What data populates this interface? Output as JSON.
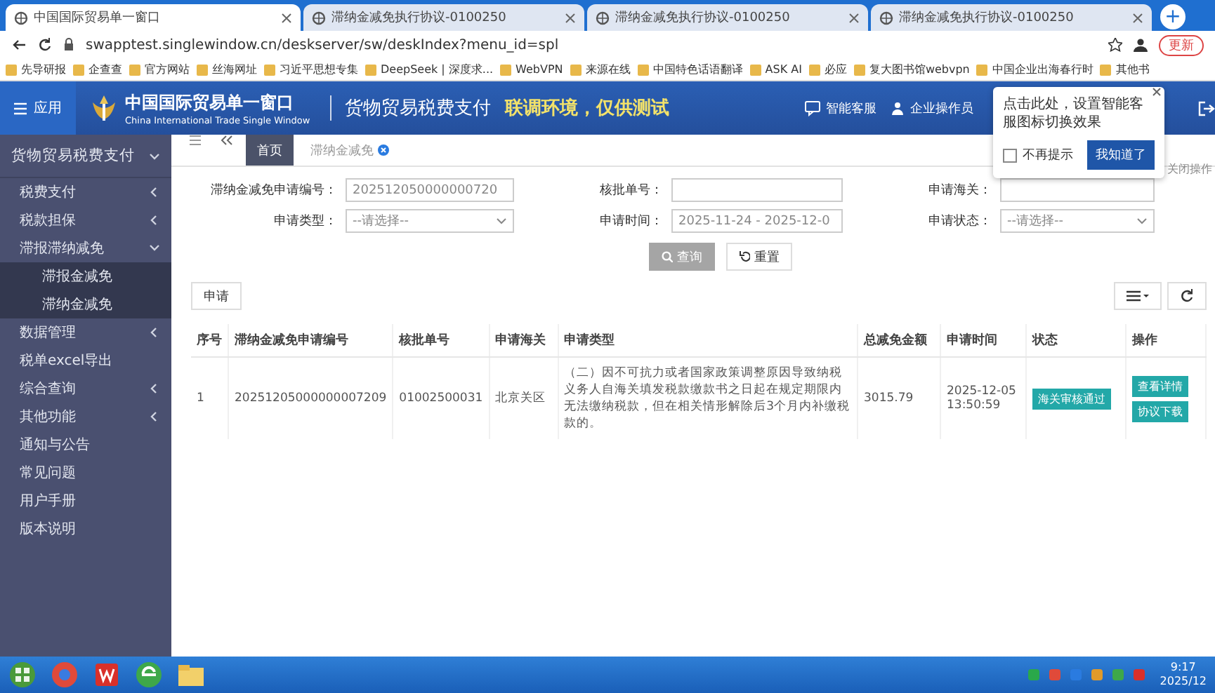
{
  "browser": {
    "tabs": [
      {
        "title": "中国国际贸易单一窗口",
        "selected": true
      },
      {
        "title": "滞纳金减免执行协议-0100250",
        "selected": false
      },
      {
        "title": "滞纳金减免执行协议-0100250",
        "selected": false
      },
      {
        "title": "滞纳金减免执行协议-0100250",
        "selected": false
      }
    ],
    "new_tab": "+",
    "url": "swapptest.singlewindow.cn/deskserver/sw/deskIndex?menu_id=spl",
    "update_button": "更新",
    "bookmarks": [
      "先导研报",
      "企查查",
      "官方网站",
      "丝海网址",
      "习近平思想专集",
      "DeepSeek | 深度求...",
      "WebVPN",
      "来源在线",
      "中国特色话语翻译",
      "ASK AI",
      "必应",
      "复大图书馆webvpn",
      "中国企业出海春行时",
      "其他书"
    ]
  },
  "header": {
    "menu_label": "应用",
    "logo_title": "中国国际贸易单一窗口",
    "logo_subtitle": "China International Trade Single Window",
    "system": "货物贸易税费支付",
    "env_notice": "联调环境，仅供测试",
    "links": [
      "智能客服",
      "企业操作员"
    ]
  },
  "popup": {
    "message": "点击此处，设置智能客服图标切换效果",
    "checkbox": {
      "label": "不再提示",
      "checked": false
    },
    "button": "我知道了",
    "behind_text": "关闭操作"
  },
  "sidebar": {
    "title": "货物贸易税费支付",
    "items": [
      {
        "label": "税费支付",
        "kind": "group",
        "expanded": false
      },
      {
        "label": "税款担保",
        "kind": "group",
        "expanded": false
      },
      {
        "label": "滞报滞纳减免",
        "kind": "group",
        "expanded": true,
        "children": [
          {
            "label": "滞报金减免"
          },
          {
            "label": "滞纳金减免"
          }
        ]
      },
      {
        "label": "数据管理",
        "kind": "group",
        "expanded": false
      },
      {
        "label": "税单excel导出",
        "kind": "link"
      },
      {
        "label": "综合查询",
        "kind": "group",
        "expanded": false
      },
      {
        "label": "其他功能",
        "kind": "group",
        "expanded": false
      },
      {
        "label": "通知与公告",
        "kind": "link"
      },
      {
        "label": "常见问题",
        "kind": "link"
      },
      {
        "label": "用户手册",
        "kind": "link"
      },
      {
        "label": "版本说明",
        "kind": "link"
      }
    ]
  },
  "page_tabs": [
    {
      "label": "首页",
      "selected": true,
      "closable": false
    },
    {
      "label": "滞纳金减免",
      "selected": false,
      "closable": true
    }
  ],
  "filters": [
    {
      "label": "滞纳金减免申请编号：",
      "kind": "input",
      "value": "202512050000000720"
    },
    {
      "label": "核批单号：",
      "kind": "input"
    },
    {
      "label": "申请海关：",
      "kind": "input"
    },
    {
      "label": "申请类型：",
      "kind": "select",
      "value": "--请选择--"
    },
    {
      "label": "申请时间：",
      "kind": "input",
      "value": "2025-11-24 - 2025-12-0"
    },
    {
      "label": "申请状态：",
      "kind": "select",
      "value": "--请选择--"
    }
  ],
  "search_button": "查询",
  "reset_button": "重置",
  "apply_button": "申请",
  "table": {
    "columns": [
      "序号",
      "滞纳金减免申请编号",
      "核批单号",
      "申请海关",
      "申请类型",
      "总减免金额",
      "申请时间",
      "状态",
      "操作"
    ],
    "rows": [
      {
        "cells": [
          "1",
          "20251205000000007209",
          "01002500031",
          "北京关区",
          "（二）因不可抗力或者国家政策调整原因导致纳税义务人自海关填发税款缴款书之日起在规定期限内无法缴纳税款，但在相关情形解除后3个月内补缴税款的。",
          "3015.79",
          "2025-12-05 13:50:59"
        ],
        "status": "海关审核通过",
        "actions": [
          "查看详情",
          "协议下载"
        ]
      }
    ]
  },
  "taskbar": {
    "time": "9:17",
    "date": "2025/12"
  }
}
